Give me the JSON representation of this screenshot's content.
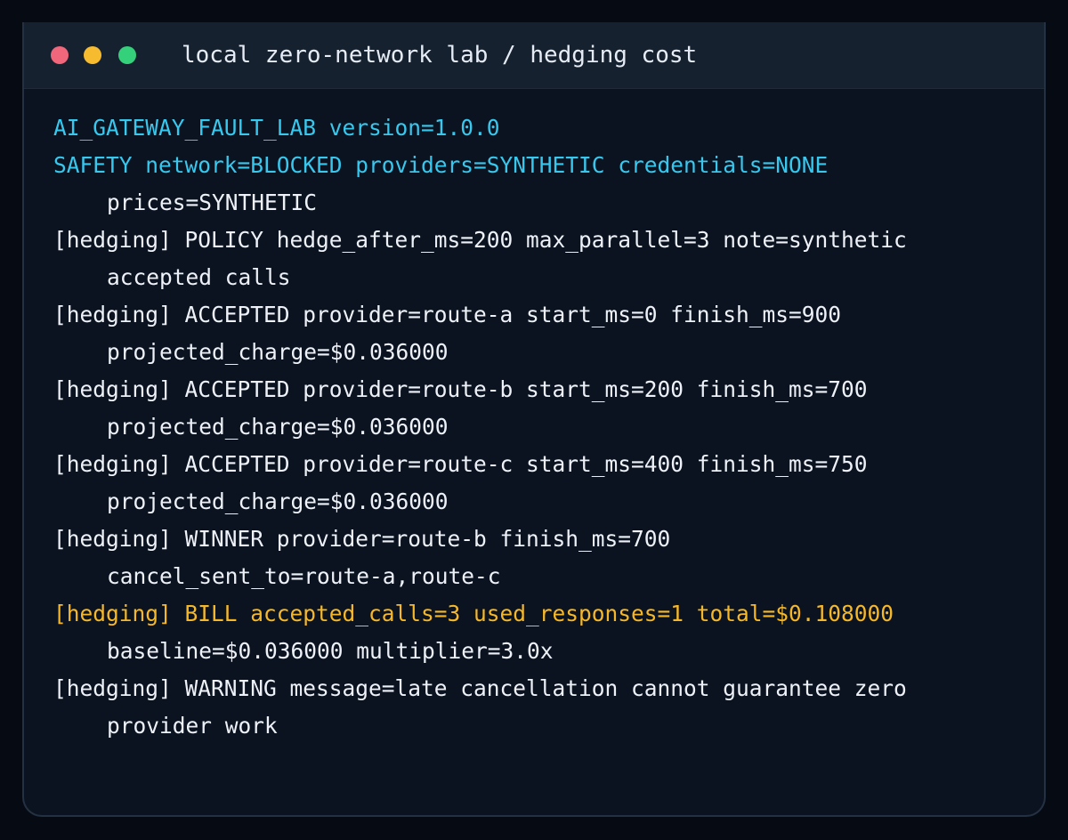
{
  "window": {
    "title": "local zero-network lab / hedging cost",
    "controls": {
      "close_color": "#f0667a",
      "minimize_color": "#f7bb30",
      "maximize_color": "#35d07a"
    }
  },
  "colors": {
    "background": "#060a12",
    "terminal_bg": "#0b1320",
    "titlebar_bg": "#162130",
    "text_default": "#eef2f8",
    "text_cyan": "#38c8ee",
    "text_amber": "#f6b828"
  },
  "terminal": {
    "lines": [
      {
        "text": "AI_GATEWAY_FAULT_LAB version=1.0.0",
        "style": "cyan",
        "indent": false
      },
      {
        "text": "SAFETY network=BLOCKED providers=SYNTHETIC credentials=NONE",
        "style": "cyan",
        "indent": false
      },
      {
        "text": "prices=SYNTHETIC",
        "style": "default",
        "indent": true
      },
      {
        "text": "[hedging] POLICY hedge_after_ms=200 max_parallel=3 note=synthetic",
        "style": "default",
        "indent": false
      },
      {
        "text": "accepted calls",
        "style": "default",
        "indent": true
      },
      {
        "text": "[hedging] ACCEPTED provider=route-a start_ms=0 finish_ms=900",
        "style": "default",
        "indent": false
      },
      {
        "text": "projected_charge=$0.036000",
        "style": "default",
        "indent": true
      },
      {
        "text": "[hedging] ACCEPTED provider=route-b start_ms=200 finish_ms=700",
        "style": "default",
        "indent": false
      },
      {
        "text": "projected_charge=$0.036000",
        "style": "default",
        "indent": true
      },
      {
        "text": "[hedging] ACCEPTED provider=route-c start_ms=400 finish_ms=750",
        "style": "default",
        "indent": false
      },
      {
        "text": "projected_charge=$0.036000",
        "style": "default",
        "indent": true
      },
      {
        "text": "[hedging] WINNER provider=route-b finish_ms=700",
        "style": "default",
        "indent": false
      },
      {
        "text": "cancel_sent_to=route-a,route-c",
        "style": "default",
        "indent": true
      },
      {
        "text": "[hedging] BILL accepted_calls=3 used_responses=1 total=$0.108000",
        "style": "amber",
        "indent": false
      },
      {
        "text": "baseline=$0.036000 multiplier=3.0x",
        "style": "default",
        "indent": true
      },
      {
        "text": "[hedging] WARNING message=late cancellation cannot guarantee zero",
        "style": "default",
        "indent": false
      },
      {
        "text": "provider work",
        "style": "default",
        "indent": true
      }
    ]
  }
}
